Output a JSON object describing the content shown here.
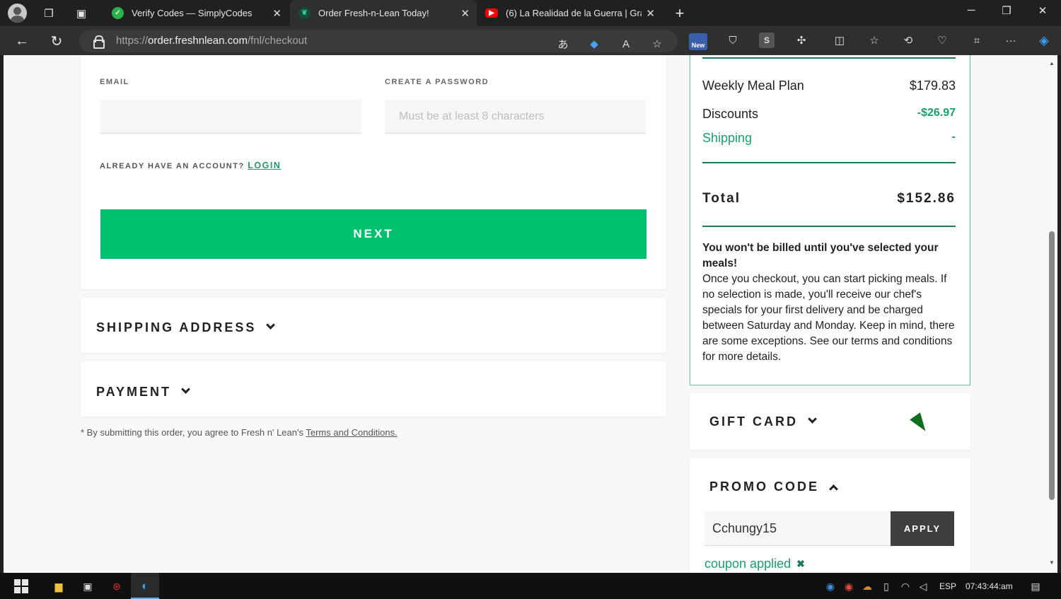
{
  "browser": {
    "tabs": [
      {
        "title": "Verify Codes — SimplyCodes",
        "icon": "simplycodes-icon",
        "color": "#29b24a"
      },
      {
        "title": "Order Fresh-n-Lean Today!",
        "icon": "freshnlean-leaf-icon",
        "color": "#1aa06a",
        "active": true
      },
      {
        "title": "(6) La Realidad de la Guerra | Grá",
        "icon": "youtube-icon",
        "color": "#ff0000"
      }
    ],
    "url_prefix": "https://",
    "url_domain": "order.freshnlean.com",
    "url_path": "/fnl/checkout",
    "new_badge": "New"
  },
  "form": {
    "email_label": "EMAIL",
    "email_value": "",
    "password_label": "CREATE A PASSWORD",
    "password_placeholder": "Must be at least 8 characters",
    "already_text": "ALREADY HAVE AN ACCOUNT?",
    "login_link": "LOGIN",
    "next_button": "NEXT"
  },
  "sections": {
    "shipping": "SHIPPING ADDRESS",
    "payment": "PAYMENT"
  },
  "disclaimer": {
    "text": "* By submitting this order, you agree to Fresh n' Lean's",
    "link": "Terms and Conditions."
  },
  "summary": {
    "plan_label": "Weekly Meal Plan",
    "plan_value": "$179.83",
    "discounts_label": "Discounts",
    "discounts_value": "-$26.97",
    "shipping_label": "Shipping",
    "shipping_value": "-",
    "total_label": "Total",
    "total_value": "$152.86",
    "bill_heading": "You won't be billed until you've selected your meals!",
    "bill_body": "Once you checkout, you can start picking meals. If no selection is made, you'll receive our chef's specials for your first delivery and be charged between Saturday and Monday. Keep in mind, there are some exceptions. See our terms and conditions for more details."
  },
  "gift_card": {
    "title": "GIFT CARD"
  },
  "promo": {
    "title": "PROMO CODE",
    "code_value": "Cchungy15",
    "apply_button": "APPLY",
    "status": "coupon applied",
    "remove_symbol": "✖"
  },
  "taskbar": {
    "language": "ESP",
    "time": "07:43:44:am"
  },
  "colors": {
    "accent_green": "#00bf6f",
    "link_green": "#1aa06a",
    "summary_border": "#5ac8a0"
  }
}
